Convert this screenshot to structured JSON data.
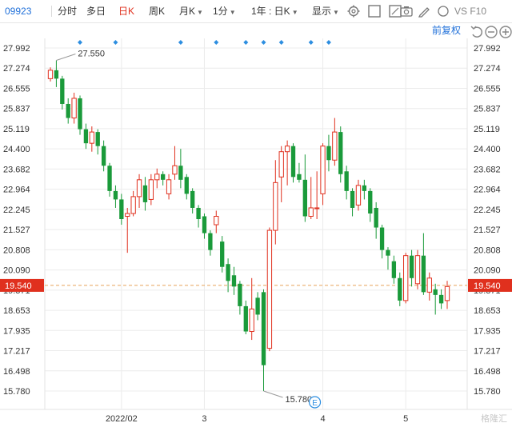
{
  "toolbar": {
    "code": "09923",
    "items": [
      {
        "label": "分时",
        "active": false
      },
      {
        "label": "多日",
        "active": false
      },
      {
        "label": "日K",
        "active": true
      },
      {
        "label": "周K",
        "active": false
      },
      {
        "label": "月K",
        "active": false,
        "dropdown": true
      },
      {
        "label": "1分",
        "active": false,
        "dropdown": true
      },
      {
        "label": "1年 : 日K",
        "active": false,
        "dropdown": true
      },
      {
        "label": "显示",
        "active": false,
        "dropdown": true
      }
    ],
    "vsf_label": "VS F10",
    "icons": [
      "settings-icon",
      "layout-icon",
      "camera-icon",
      "draw-icon"
    ]
  },
  "adjust": {
    "label": "前复权"
  },
  "watermark": "格隆汇",
  "chart_data": {
    "type": "candlestick",
    "y_ticks": [
      "27.992",
      "27.274",
      "26.555",
      "25.837",
      "25.119",
      "24.400",
      "23.682",
      "22.964",
      "22.245",
      "21.527",
      "20.808",
      "20.090",
      "19.371",
      "18.653",
      "17.935",
      "17.217",
      "16.498",
      "15.780"
    ],
    "ylim": [
      15.78,
      27.992
    ],
    "x_ticks": [
      {
        "label": "2022/02",
        "index": 12
      },
      {
        "label": "3",
        "index": 26
      },
      {
        "label": "4",
        "index": 46
      },
      {
        "label": "5",
        "index": 60
      }
    ],
    "current_price": "19.540",
    "annotations": [
      {
        "text": "27.550",
        "index": 1,
        "value": 27.55
      },
      {
        "text": "15.780",
        "index": 36,
        "value": 15.78
      }
    ],
    "event_marker": "E",
    "markers_top_index": [
      5,
      11,
      22,
      28,
      33,
      36,
      39,
      44,
      47
    ],
    "up_color": "#e0301e",
    "down_color": "#1a9a3a",
    "candles": [
      [
        26.9,
        27.2,
        26.8,
        27.3
      ],
      [
        27.2,
        26.9,
        26.6,
        27.55
      ],
      [
        26.9,
        26.0,
        25.8,
        27.0
      ],
      [
        26.0,
        25.5,
        25.3,
        26.2
      ],
      [
        25.5,
        26.2,
        25.3,
        26.4
      ],
      [
        26.2,
        25.1,
        24.9,
        26.3
      ],
      [
        25.1,
        24.6,
        24.4,
        25.3
      ],
      [
        24.6,
        25.0,
        24.3,
        25.2
      ],
      [
        25.0,
        24.5,
        24.2,
        25.1
      ],
      [
        24.5,
        23.8,
        23.6,
        24.7
      ],
      [
        23.8,
        22.9,
        22.7,
        23.9
      ],
      [
        22.9,
        22.6,
        22.3,
        23.1
      ],
      [
        22.6,
        21.9,
        21.7,
        22.8
      ],
      [
        22.0,
        22.1,
        20.7,
        22.3
      ],
      [
        22.1,
        22.7,
        22.0,
        22.9
      ],
      [
        22.7,
        23.3,
        22.3,
        23.5
      ],
      [
        23.1,
        22.5,
        22.2,
        23.4
      ],
      [
        22.6,
        23.3,
        22.4,
        23.5
      ],
      [
        23.3,
        23.5,
        23.0,
        23.7
      ],
      [
        23.5,
        23.3,
        23.1,
        23.6
      ],
      [
        22.8,
        23.3,
        22.6,
        23.5
      ],
      [
        23.5,
        23.8,
        23.3,
        24.5
      ],
      [
        23.8,
        23.3,
        23.0,
        24.4
      ],
      [
        23.4,
        22.8,
        22.6,
        23.5
      ],
      [
        22.9,
        22.3,
        22.1,
        23.0
      ],
      [
        22.3,
        21.9,
        21.6,
        22.4
      ],
      [
        22.0,
        21.4,
        21.2,
        22.1
      ],
      [
        21.4,
        20.8,
        20.6,
        21.5
      ],
      [
        21.7,
        22.0,
        21.4,
        22.2
      ],
      [
        21.1,
        20.2,
        20.0,
        21.3
      ],
      [
        20.3,
        19.7,
        19.3,
        20.5
      ],
      [
        19.9,
        19.5,
        19.2,
        20.2
      ],
      [
        19.6,
        18.8,
        18.5,
        19.7
      ],
      [
        18.8,
        17.9,
        17.8,
        19.0
      ],
      [
        17.9,
        18.7,
        17.6,
        19.8
      ],
      [
        19.1,
        18.5,
        18.3,
        19.3
      ],
      [
        19.3,
        16.7,
        15.78,
        19.4
      ],
      [
        17.3,
        21.5,
        17.2,
        21.6
      ],
      [
        21.5,
        23.2,
        21.0,
        24.0
      ],
      [
        23.4,
        24.3,
        22.5,
        24.5
      ],
      [
        24.3,
        24.5,
        23.1,
        24.7
      ],
      [
        24.5,
        23.4,
        23.2,
        24.6
      ],
      [
        23.5,
        23.3,
        23.2,
        23.9
      ],
      [
        23.3,
        22.0,
        21.8,
        24.2
      ],
      [
        22.0,
        22.3,
        21.9,
        23.4
      ],
      [
        22.3,
        22.3,
        21.9,
        23.6
      ],
      [
        22.8,
        24.5,
        22.4,
        24.6
      ],
      [
        24.5,
        24.0,
        23.6,
        24.9
      ],
      [
        24.0,
        25.0,
        23.8,
        25.5
      ],
      [
        25.0,
        23.5,
        23.2,
        25.2
      ],
      [
        23.6,
        22.9,
        22.6,
        23.8
      ],
      [
        22.9,
        22.3,
        22.0,
        23.0
      ],
      [
        22.4,
        23.1,
        22.2,
        23.3
      ],
      [
        23.1,
        22.9,
        22.6,
        23.3
      ],
      [
        22.9,
        22.1,
        21.8,
        23.0
      ],
      [
        22.3,
        21.6,
        21.2,
        22.5
      ],
      [
        21.6,
        20.8,
        20.5,
        21.7
      ],
      [
        20.8,
        20.6,
        20.1,
        20.9
      ],
      [
        20.4,
        19.8,
        19.6,
        20.6
      ],
      [
        19.8,
        19.0,
        18.8,
        20.0
      ],
      [
        19.0,
        20.6,
        18.9,
        20.7
      ],
      [
        20.6,
        19.8,
        19.5,
        20.8
      ],
      [
        19.6,
        20.6,
        19.4,
        20.8
      ],
      [
        20.6,
        19.3,
        19.2,
        21.4
      ],
      [
        19.3,
        19.8,
        19.0,
        20.0
      ],
      [
        19.4,
        19.2,
        18.5,
        19.6
      ],
      [
        19.2,
        18.9,
        18.7,
        19.4
      ],
      [
        19.0,
        19.5,
        18.7,
        19.7
      ]
    ]
  }
}
